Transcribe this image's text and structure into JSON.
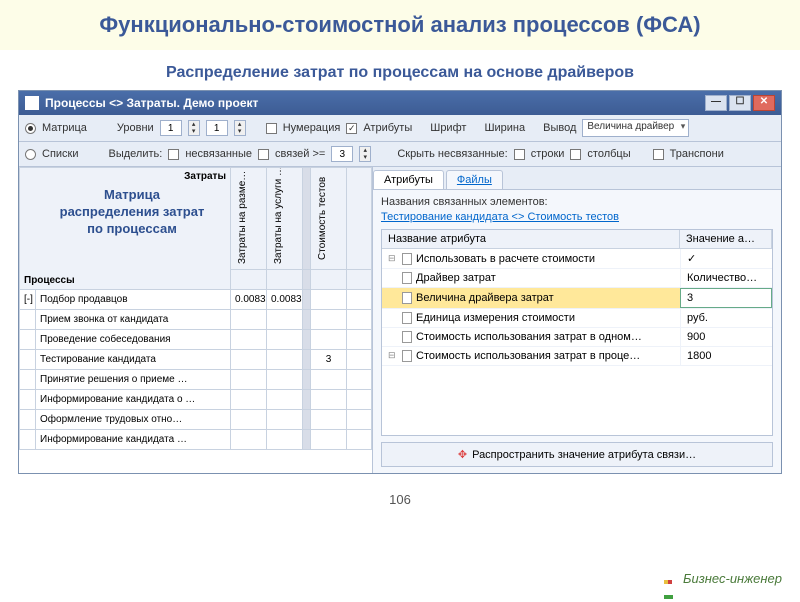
{
  "slide": {
    "title": "Функционально-стоимостной анализ процессов (ФСА)",
    "subtitle": "Распределение затрат по процессам на основе драйверов",
    "page": "106"
  },
  "window": {
    "title": "Процессы <> Затраты. Демо проект"
  },
  "toolbar": {
    "matrix": "Матрица",
    "lists": "Списки",
    "levels": "Уровни",
    "lvl1": "1",
    "lvl2": "1",
    "numbering": "Нумерация",
    "attributes": "Атрибуты",
    "font": "Шрифт",
    "width": "Ширина",
    "output": "Вывод",
    "output_val": "Величина драйвер",
    "highlight": "Выделить:",
    "unrelated": "несвязанные",
    "links_gte": "связей >=",
    "links_val": "3",
    "hide_unrel": "Скрыть несвязанные:",
    "rows": "строки",
    "cols": "столбцы",
    "transp": "Транспони"
  },
  "matrix": {
    "label1": "Матрица",
    "label2": "распределения затрат",
    "label3": "по процессам",
    "costs": "Затраты",
    "procs": "Процессы",
    "colheads": [
      "Затраты на разме…",
      "Затраты на услуги …",
      "",
      "Стоимость тестов"
    ],
    "rows": [
      {
        "toggle": "[-]",
        "name": "Подбор продавцов",
        "vals": [
          "0.0083",
          "0.0083",
          "",
          ""
        ]
      },
      {
        "toggle": "",
        "name": "Прием звонка от кандидата",
        "vals": [
          "",
          "",
          "",
          ""
        ]
      },
      {
        "toggle": "",
        "name": "Проведение собеседования",
        "vals": [
          "",
          "",
          "",
          ""
        ]
      },
      {
        "toggle": "",
        "name": "Тестирование кандидата",
        "vals": [
          "",
          "",
          "",
          "3"
        ]
      },
      {
        "toggle": "",
        "name": "Принятие решения о приеме …",
        "vals": [
          "",
          "",
          "",
          ""
        ]
      },
      {
        "toggle": "",
        "name": "Информирование кандидата о …",
        "vals": [
          "",
          "",
          "",
          ""
        ]
      },
      {
        "toggle": "",
        "name": "Оформление трудовых отно…",
        "vals": [
          "",
          "",
          "",
          ""
        ]
      },
      {
        "toggle": "",
        "name": "Информирование кандидата …",
        "vals": [
          "",
          "",
          "",
          ""
        ]
      }
    ]
  },
  "right": {
    "tab1": "Атрибуты",
    "tab2": "Файлы",
    "names_label": "Названия связанных элементов:",
    "link": "Тестирование кандидата <> Стоимость тестов",
    "col1": "Название атрибута",
    "col2": "Значение а…",
    "attrs": [
      {
        "name": "Использовать в расчете стоимости",
        "val": "✓"
      },
      {
        "name": "Драйвер затрат",
        "val": "Количество…"
      },
      {
        "name": "Величина драйвера затрат",
        "val": "3"
      },
      {
        "name": "Единица измерения стоимости",
        "val": "руб."
      },
      {
        "name": "Стоимость использования затрат в одном…",
        "val": "900"
      },
      {
        "name": "Стоимость использования затрат в проце…",
        "val": "1800"
      }
    ],
    "propagate": "Распространить значение атрибута связи…"
  },
  "brand": "Бизнес-инженер"
}
